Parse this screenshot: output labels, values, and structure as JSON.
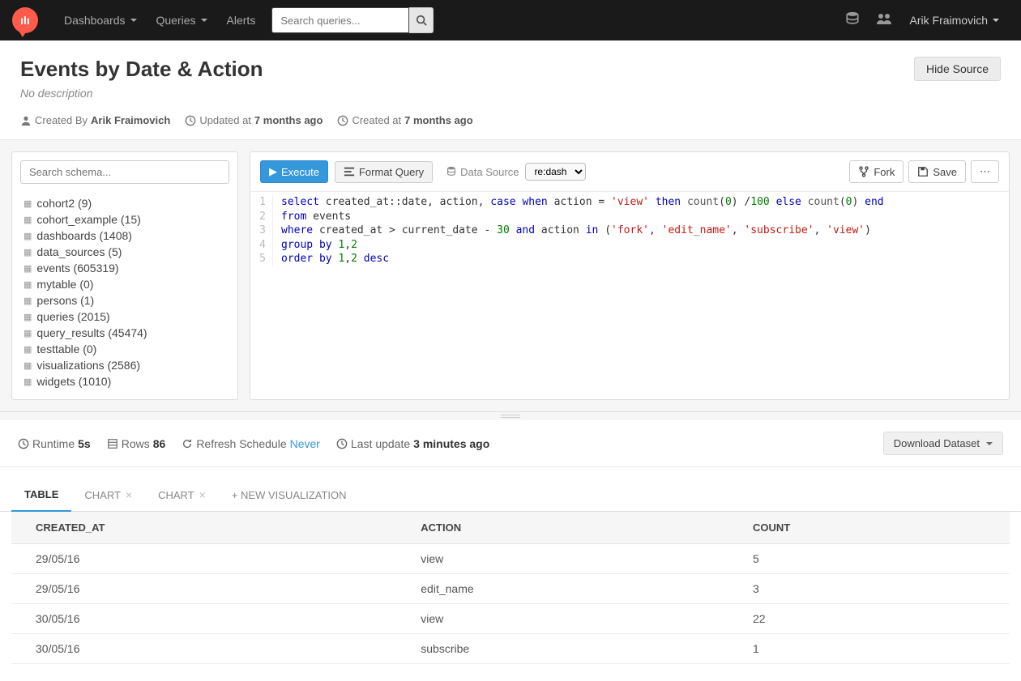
{
  "nav": {
    "items": [
      "Dashboards",
      "Queries",
      "Alerts"
    ],
    "search_placeholder": "Search queries...",
    "user": "Arik Fraimovich"
  },
  "header": {
    "title": "Events by Date & Action",
    "hide_source": "Hide Source",
    "description": "No description",
    "created_by_label": "Created By",
    "created_by": "Arik Fraimovich",
    "updated_label": "Updated at",
    "updated_value": "7 months ago",
    "created_label": "Created at",
    "created_value": "7 months ago"
  },
  "schema": {
    "search_placeholder": "Search schema...",
    "items": [
      "cohort2 (9)",
      "cohort_example (15)",
      "dashboards (1408)",
      "data_sources (5)",
      "events (605319)",
      "mytable (0)",
      "persons (1)",
      "queries (2015)",
      "query_results (45474)",
      "testtable (0)",
      "visualizations (2586)",
      "widgets (1010)"
    ]
  },
  "editor": {
    "execute": "Execute",
    "format": "Format Query",
    "data_source_label": "Data Source",
    "data_source_value": "re:dash",
    "fork": "Fork",
    "save": "Save",
    "more": "⋯",
    "line_numbers": [
      "1",
      "2",
      "3",
      "4",
      "5"
    ],
    "sql_raw": "select created_at::date, action, case when action = 'view' then count(0) /100 else count(0) end\nfrom events\nwhere created_at > current_date - 30 and action in ('fork', 'edit_name', 'subscribe', 'view')\ngroup by 1,2\norder by 1,2 desc"
  },
  "status": {
    "runtime_label": "Runtime",
    "runtime_value": "5s",
    "rows_label": "Rows",
    "rows_value": "86",
    "refresh_label": "Refresh Schedule",
    "refresh_value": "Never",
    "update_label": "Last update",
    "update_value": "3 minutes ago",
    "download": "Download Dataset"
  },
  "tabs": {
    "table": "TABLE",
    "chart1": "CHART",
    "chart2": "CHART",
    "newviz": "+ NEW VISUALIZATION"
  },
  "results": {
    "columns": [
      "CREATED_AT",
      "ACTION",
      "COUNT"
    ],
    "rows": [
      [
        "29/05/16",
        "view",
        "5"
      ],
      [
        "29/05/16",
        "edit_name",
        "3"
      ],
      [
        "30/05/16",
        "view",
        "22"
      ],
      [
        "30/05/16",
        "subscribe",
        "1"
      ]
    ]
  }
}
